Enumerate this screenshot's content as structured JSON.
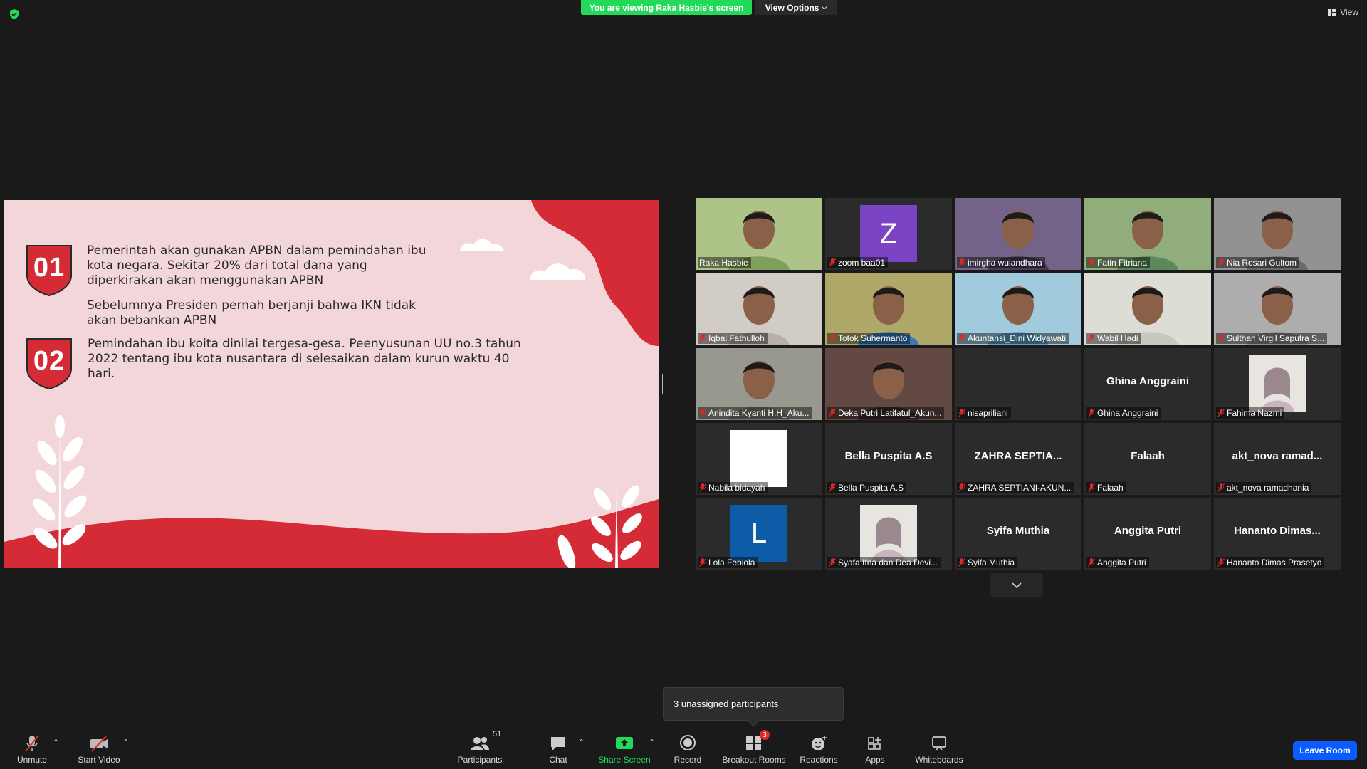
{
  "top_bar": {
    "viewing_banner": "You are viewing Raka Hasbie's screen",
    "view_options": "View Options",
    "view_label": "View"
  },
  "slide": {
    "items": [
      {
        "number": "01",
        "paragraphs": [
          "Pemerintah akan gunakan APBN dalam pemindahan ibu kota negara. Sekitar 20% dari total dana yang diperkirakan akan menggunakan APBN",
          "Sebelumnya Presiden pernah berjanji bahwa IKN tidak akan bebankan APBN"
        ]
      },
      {
        "number": "02",
        "paragraphs": [
          "Pemindahan ibu koita dinilai tergesa-gesa. Peenyusunan UU no.3 tahun 2022 tentang ibu kota nusantara di selesaikan dalam kurun waktu 40 hari."
        ]
      }
    ],
    "colors": {
      "background": "#f3d6d9",
      "accent": "#d42b36"
    }
  },
  "participants": [
    {
      "name": "Raka Hasbie",
      "muted": false,
      "type": "video",
      "active": true
    },
    {
      "name": "zoom baa01",
      "muted": true,
      "type": "letter",
      "letter": "Z",
      "color": "#7b44c4"
    },
    {
      "name": "imirgha wulandhara",
      "muted": true,
      "type": "video"
    },
    {
      "name": "Fatin Fitriana",
      "muted": true,
      "type": "video"
    },
    {
      "name": "Nia Rosari Gultom",
      "muted": true,
      "type": "video"
    },
    {
      "name": "Iqbal Fathulloh",
      "muted": true,
      "type": "video"
    },
    {
      "name": "Totok Suhermanto",
      "muted": true,
      "type": "video"
    },
    {
      "name": "Akuntansi_Dini Widyawati",
      "muted": true,
      "type": "video"
    },
    {
      "name": "Wabil Hadi",
      "muted": true,
      "type": "video"
    },
    {
      "name": "Sulthan Virgil Saputra S...",
      "muted": true,
      "type": "video"
    },
    {
      "name": "Anindita Kyanti H.H_Aku...",
      "muted": true,
      "type": "video"
    },
    {
      "name": "Deka Putri Latifatul_Akun...",
      "muted": true,
      "type": "video"
    },
    {
      "name": "nisapriliani",
      "muted": true,
      "type": "blank"
    },
    {
      "name": "Ghina Anggraini",
      "muted": true,
      "type": "name",
      "big": "Ghina Anggraini"
    },
    {
      "name": "Fahima Nazmi",
      "muted": true,
      "type": "photo"
    },
    {
      "name": "Nabila bidayah",
      "muted": true,
      "type": "white"
    },
    {
      "name": "Bella Puspita A.S",
      "muted": true,
      "type": "name",
      "big": "Bella Puspita A.S"
    },
    {
      "name": "ZAHRA SEPTIANI-AKUN...",
      "muted": true,
      "type": "name",
      "big": "ZAHRA  SEPTIA..."
    },
    {
      "name": "Falaah",
      "muted": true,
      "type": "name",
      "big": "Falaah"
    },
    {
      "name": "akt_nova ramadhania",
      "muted": true,
      "type": "name",
      "big": "akt_nova  ramad..."
    },
    {
      "name": "Lola Febiola",
      "muted": true,
      "type": "letter",
      "letter": "L",
      "color": "#0d5ca8"
    },
    {
      "name": "Syafa Ifna dan Dea Devi...",
      "muted": true,
      "type": "photo"
    },
    {
      "name": "Syifa Muthia",
      "muted": true,
      "type": "name",
      "big": "Syifa Muthia"
    },
    {
      "name": "Anggita Putri",
      "muted": true,
      "type": "name",
      "big": "Anggita Putri"
    },
    {
      "name": "Hananto Dimas Prasetyo",
      "muted": true,
      "type": "name",
      "big": "Hananto  Dimas..."
    }
  ],
  "tooltip": "3 unassigned participants",
  "toolbar": {
    "unmute": "Unmute",
    "start_video": "Start Video",
    "participants": "Participants",
    "participants_count": "51",
    "chat": "Chat",
    "share_screen": "Share Screen",
    "record": "Record",
    "breakout_rooms": "Breakout Rooms",
    "breakout_count": "3",
    "reactions": "Reactions",
    "apps": "Apps",
    "whiteboards": "Whiteboards",
    "leave": "Leave Room"
  }
}
